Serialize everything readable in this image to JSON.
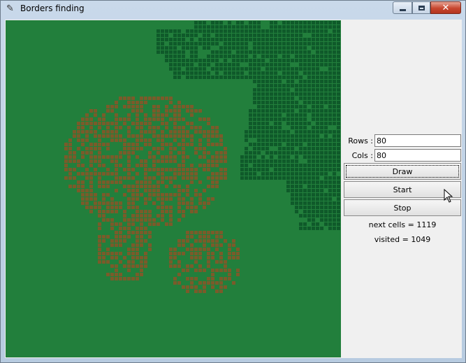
{
  "window": {
    "title": "Borders finding"
  },
  "controls": {
    "rows_label": "Rows :",
    "rows_value": "80",
    "cols_label": "Cols :",
    "cols_value": "80",
    "draw_label": "Draw",
    "start_label": "Start",
    "stop_label": "Stop"
  },
  "status": {
    "next_cells": "next cells = 1119",
    "visited": "visited = 1049"
  },
  "colors": {
    "background": "#227f3c",
    "visited_region": "#0f5a2a",
    "border_cells": "#7a5b2a",
    "grid_lines": "#0b3f1c"
  },
  "icons": {
    "app": "feather-icon",
    "minimize": "minimize-icon",
    "maximize": "maximize-icon",
    "close": "close-icon",
    "cursor": "mouse-pointer-icon"
  }
}
